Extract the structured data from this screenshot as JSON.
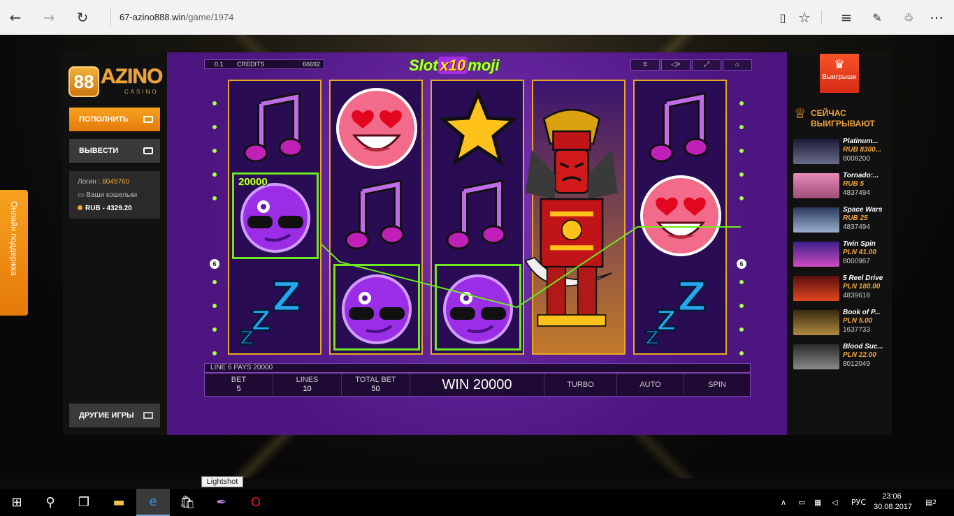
{
  "browser": {
    "url_host": "67-azino888.win",
    "url_path": "/game/1974"
  },
  "left_panel": {
    "logo_eight": "88",
    "logo_text": "AZINO",
    "logo_sub": "CASINO",
    "deposit_label": "ПОПОЛНИТЬ",
    "withdraw_label": "ВЫВЕСТИ",
    "login_label": "Логин :",
    "login_value": "8045760",
    "wallets_label": "Ваши кошельки",
    "balance": "RUB - 4329.20",
    "other_games_label": "ДРУГИЕ ИГРЫ"
  },
  "support_tab": "Онлайн поддержка",
  "game": {
    "coin_value": "0.1",
    "credits_label": "CREDITS",
    "credits_value": "66692",
    "title_left": "Slot",
    "title_x10": "x10",
    "title_right": "moji",
    "win_amount_label": "20000",
    "line_left": "6",
    "line_right": "6",
    "line_info": "LINE 6 PAYS 20000",
    "bet_label": "BET",
    "bet_value": "5",
    "lines_label": "LINES",
    "lines_value": "10",
    "total_bet_label": "TOTAL BET",
    "total_bet_value": "50",
    "win_text": "WIN 20000",
    "turbo_label": "TURBO",
    "auto_label": "AUTO",
    "spin_label": "SPIN"
  },
  "right_panel": {
    "wins_badge": "Выигрыши",
    "now_title_1": "СЕЙЧАС",
    "now_title_2": "ВЫИГРЫВАЮТ",
    "winners": [
      {
        "name": "Platinum...",
        "amount": "RUB 8300...",
        "uid": "8008200"
      },
      {
        "name": "Tornado:...",
        "amount": "RUB 5",
        "uid": "4837494"
      },
      {
        "name": "Space Wars",
        "amount": "RUB 25",
        "uid": "4837494"
      },
      {
        "name": "Twin Spin",
        "amount": "PLN 41.00",
        "uid": "8000967"
      },
      {
        "name": "5 Reel Drive",
        "amount": "PLN 180.00",
        "uid": "4839618"
      },
      {
        "name": "Book of P...",
        "amount": "PLN 5.00",
        "uid": "1637733"
      },
      {
        "name": "Blood Suc...",
        "amount": "PLN 22.00",
        "uid": "8012049"
      }
    ]
  },
  "tooltip": "Lightshot",
  "taskbar": {
    "lang": "РУС",
    "time": "23:06",
    "date": "30.08.2017",
    "notif_count": "2"
  },
  "colors": {
    "accent_orange": "#f7a21f",
    "game_purple": "#5a1e93",
    "win_green": "#6cea1f",
    "reel_border": "#e8a826"
  }
}
